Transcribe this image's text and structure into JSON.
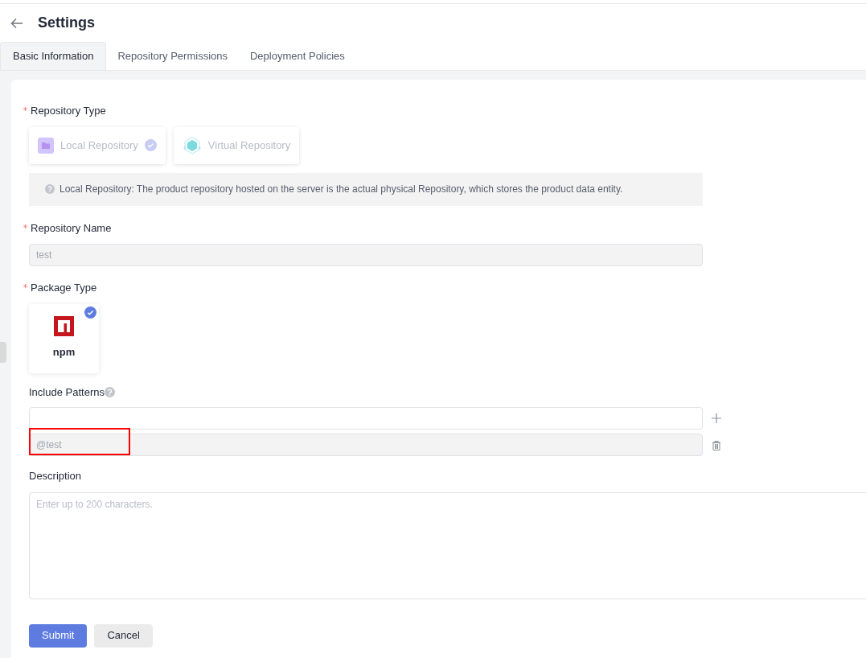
{
  "header": {
    "title": "Settings"
  },
  "tabs": [
    {
      "label": "Basic Information",
      "selected": true
    },
    {
      "label": "Repository Permissions",
      "selected": false
    },
    {
      "label": "Deployment Policies",
      "selected": false
    }
  ],
  "repository_type": {
    "label": "Repository Type",
    "required": true,
    "options": [
      {
        "kind": "local",
        "label": "Local Repository",
        "selected": true,
        "disabled": true
      },
      {
        "kind": "virtual",
        "label": "Virtual Repository",
        "selected": false,
        "disabled": true
      }
    ],
    "hint": "Local Repository: The product repository hosted on the server is the actual physical Repository, which stores the product data entity."
  },
  "repository_name": {
    "label": "Repository Name",
    "required": true,
    "value": "test",
    "disabled": true
  },
  "package_type": {
    "label": "Package Type",
    "required": true,
    "options": [
      {
        "label": "npm",
        "selected": true
      }
    ]
  },
  "include_patterns": {
    "label": "Include Patterns",
    "rows": [
      {
        "kind": "add",
        "value": "",
        "disabled": false
      },
      {
        "kind": "delete",
        "value": "@test",
        "disabled": true,
        "highlighted": true
      }
    ]
  },
  "description": {
    "label": "Description",
    "placeholder": "Enter up to 200 characters."
  },
  "buttons": [
    {
      "kind": "primary",
      "label": "Submit"
    },
    {
      "kind": "secondary",
      "label": "Cancel"
    }
  ]
}
